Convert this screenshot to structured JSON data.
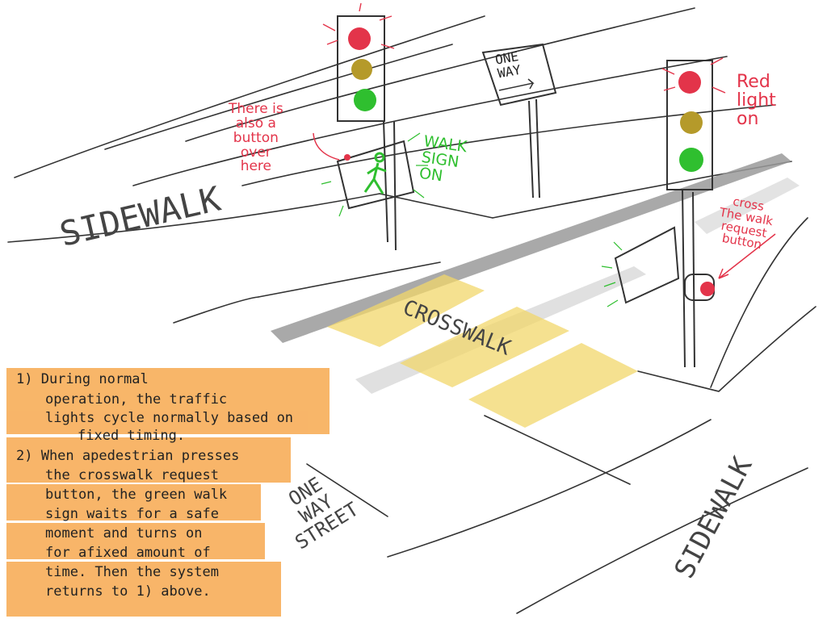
{
  "labels": {
    "sidewalk_left": "SIDEWALK",
    "sidewalk_right": "SIDEWALK",
    "crosswalk": "CROSSWALK",
    "one_way_street": "ONE\nWAY\nSTREET",
    "one_way_sign": "ONE\nWAY",
    "button_note": "There is\nalso a\nbutton\nover\nhere",
    "walk_sign_on": "WALK\nSIGN\nON",
    "red_light_on": "Red\nlight\non",
    "cross_request": "cross\nThe walk\nrequest\nbutton"
  },
  "notes": [
    "1) During normal",
    "operation, the traffic",
    "lights cycle normally based on",
    "fixed timing.",
    "2) When apedestrian presses",
    "the crosswalk request",
    "button, the green walk",
    "sign waits for a safe",
    "moment and turns on",
    "for afixed amount of",
    "time. Then the system",
    "returns to 1) above."
  ],
  "colors": {
    "red": "#e3344a",
    "green": "#2fbf2f",
    "amber": "#b59a2a",
    "highlight_orange": "#f7a94f",
    "crosswalk_yellow": "#f2d76b"
  }
}
